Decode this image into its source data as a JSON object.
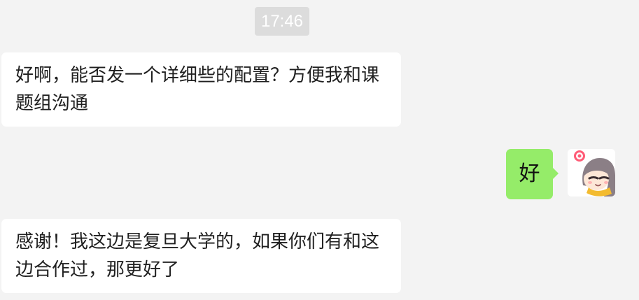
{
  "chat": {
    "timestamp": "17:46",
    "messages": [
      {
        "direction": "incoming",
        "text": "好啊，能否发一个详细些的配置？方便我和课题组沟通"
      },
      {
        "direction": "outgoing",
        "text": "好",
        "avatar": "cartoon-avatar-icon"
      },
      {
        "direction": "incoming",
        "text": "感谢！我这边是复旦大学的，如果你们有和这边合作过，那更好了"
      }
    ]
  },
  "colors": {
    "background": "#f3f3f3",
    "incoming_bubble": "#ffffff",
    "outgoing_bubble": "#95ec69",
    "timestamp_bg": "#dcdcdc",
    "timestamp_text": "#ffffff"
  }
}
